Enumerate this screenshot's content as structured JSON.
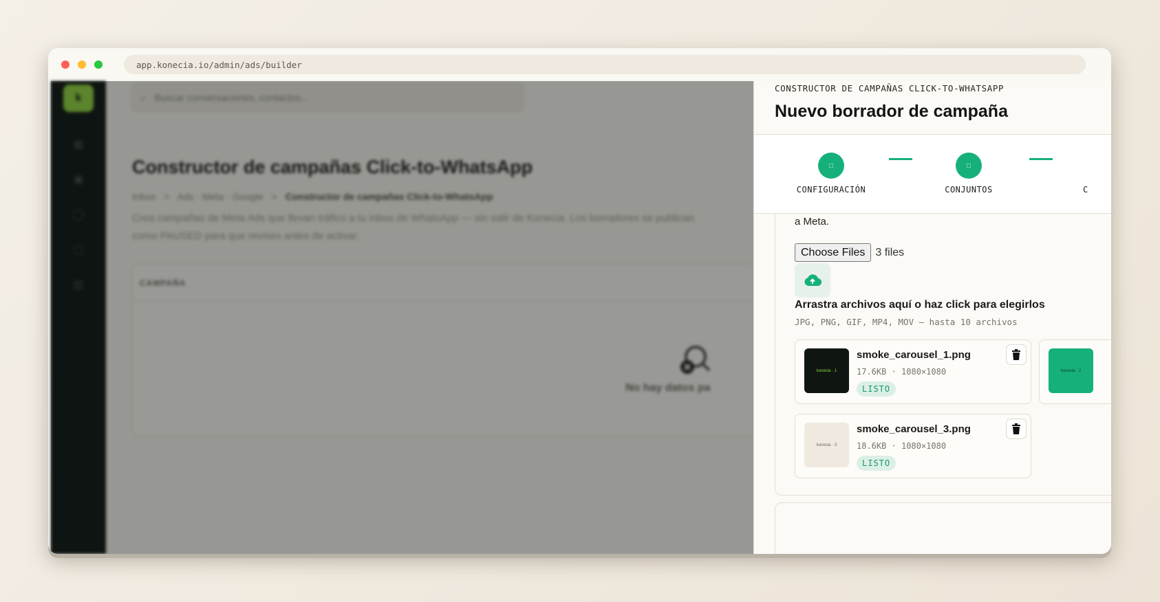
{
  "browser": {
    "url": "app.konecia.io/admin/ads/builder"
  },
  "sidebar": {
    "logo_letter": "k",
    "icons": [
      "grid-icon",
      "inbox-icon",
      "user-icon",
      "document-icon",
      "chart-icon"
    ]
  },
  "main": {
    "search_placeholder": "Buscar conversaciones, contactos...",
    "title": "Constructor de campañas Click-to-WhatsApp",
    "breadcrumb": [
      "Inbox",
      "Ads · Meta · Google",
      "Constructor de campañas Click-to-WhatsApp"
    ],
    "breadcrumb_sep": ">",
    "description": "Crea campañas de Meta Ads que llevan tráfico a tu inbox de WhatsApp — sin salir de Konecia. Los borradores se publican como PAUSED para que revises antes de activar.",
    "table_header": "CAMPAÑA",
    "empty_text": "No hay datos pa"
  },
  "drawer": {
    "eyebrow": "CONSTRUCTOR DE CAMPAÑAS CLICK-TO-WHATSAPP",
    "title": "Nuevo borrador de campaña",
    "steps": [
      {
        "label": "CONFIGURACIÓN",
        "icon": "□"
      },
      {
        "label": "CONJUNTOS",
        "icon": "□"
      },
      {
        "label": "C",
        "icon": ""
      }
    ],
    "note_tail": "a Meta.",
    "file_button": "Choose Files",
    "file_count": "3 files",
    "dropzone_title": "Arrastra archivos aquí o haz click para elegirlos",
    "dropzone_hint": "JPG, PNG, GIF, MP4, MOV — hasta 10 archivos",
    "files": [
      {
        "name": "smoke_carousel_1.png",
        "size": "17.6KB",
        "dims": "1080×1080",
        "status": "LISTO",
        "thumb_text": "konecia · 1",
        "thumb_bg": "#0f1612",
        "thumb_fg": "#8fd43f"
      },
      {
        "name": "",
        "size": "",
        "dims": "",
        "status": "",
        "thumb_text": "konecia · 2",
        "thumb_bg": "#16b07b",
        "thumb_fg": "#0d3d2b"
      },
      {
        "name": "smoke_carousel_3.png",
        "size": "18.6KB",
        "dims": "1080×1080",
        "status": "LISTO",
        "thumb_text": "konecia · 3",
        "thumb_bg": "#efe9df",
        "thumb_fg": "#6a665f"
      }
    ]
  },
  "colors": {
    "accent": "#16b07b",
    "brand_lime": "#8fd43f",
    "sidebar_bg": "#0c1410"
  }
}
